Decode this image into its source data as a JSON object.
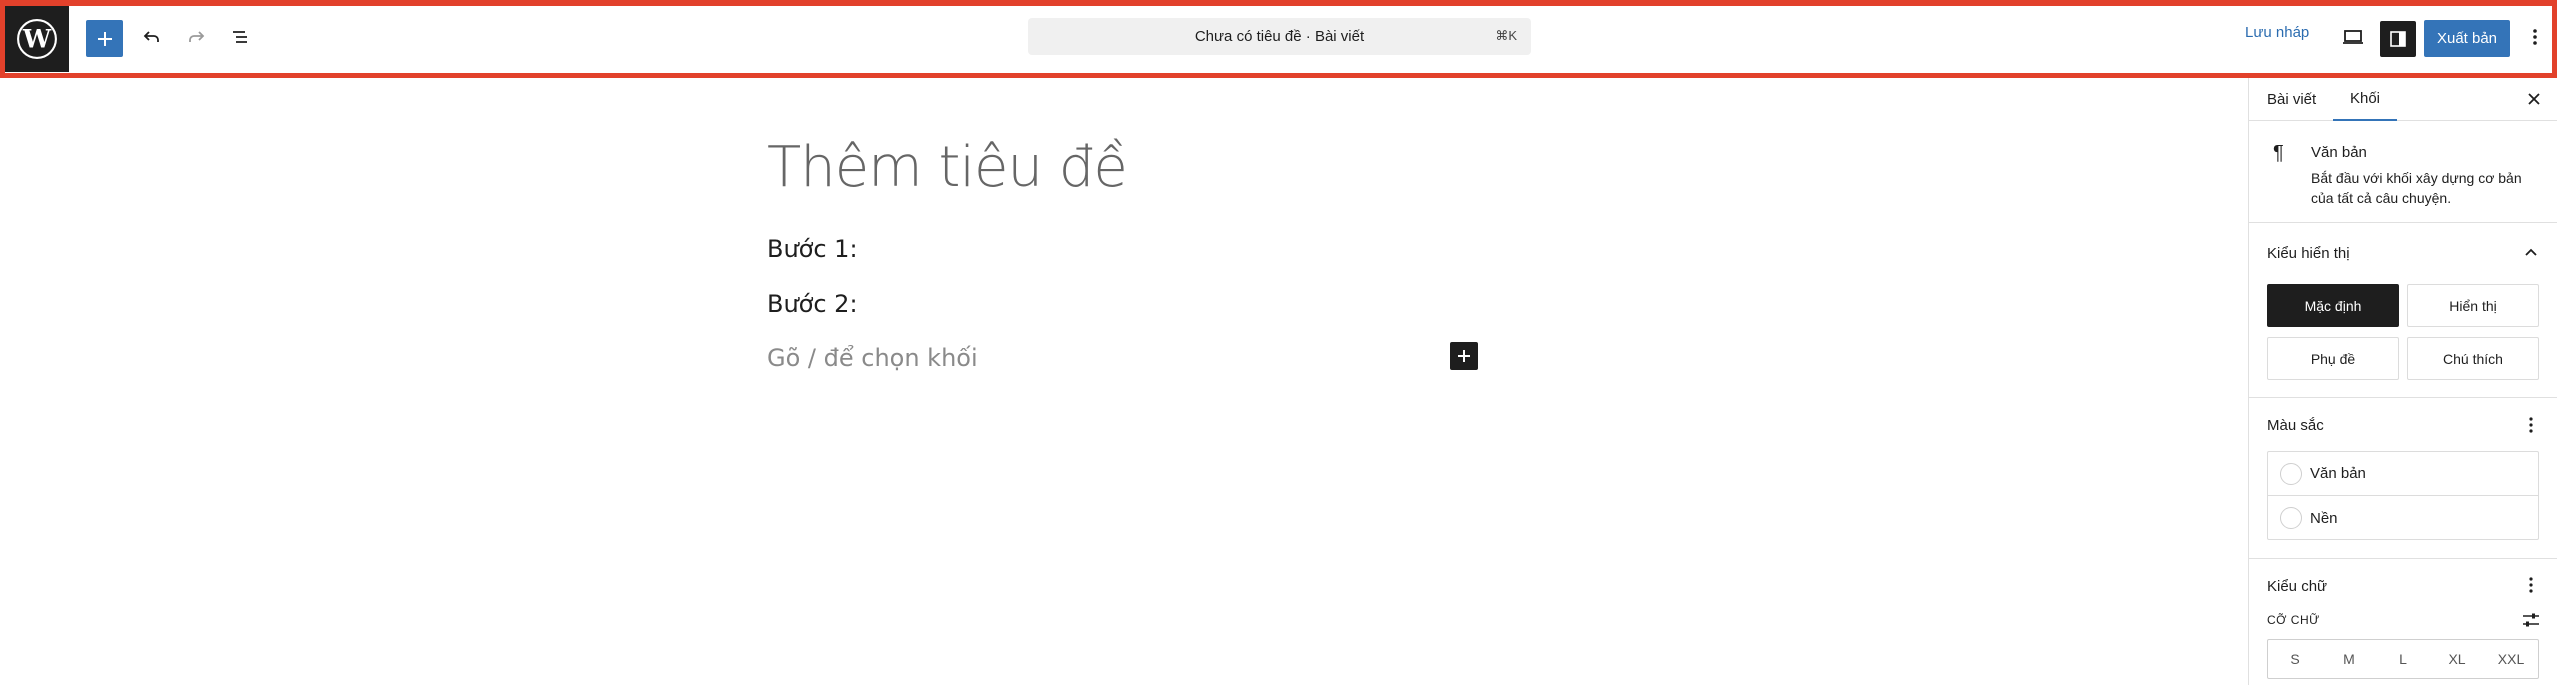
{
  "toolbar": {
    "document_title": "Chưa có tiêu đề · Bài viết",
    "shortcut": "⌘K",
    "save_draft": "Lưu nháp",
    "publish": "Xuất bản",
    "icons": [
      "wordpress-logo",
      "plus-icon",
      "undo-icon",
      "redo-icon",
      "list-view-icon",
      "desktop-preview-icon",
      "sidebar-toggle-icon",
      "more-vertical-icon"
    ]
  },
  "editor": {
    "title_placeholder": "Thêm tiêu đề",
    "paragraphs": [
      "Bước 1:",
      "Bước 2:"
    ],
    "block_placeholder": "Gõ / để chọn khối"
  },
  "sidebar": {
    "tabs": [
      "Bài viết",
      "Khối"
    ],
    "active_tab": "Khối",
    "block": {
      "name": "Văn bản",
      "description": "Bắt đầu với khối xây dựng cơ bản của tất cả câu chuyện.",
      "icon": "pilcrow-icon"
    },
    "styles": {
      "title": "Kiểu hiển thị",
      "options": [
        "Mặc định",
        "Hiển thị",
        "Phụ đề",
        "Chú thích"
      ],
      "selected": "Mặc định"
    },
    "color": {
      "title": "Màu sắc",
      "items": [
        "Văn bản",
        "Nền"
      ]
    },
    "typography": {
      "title": "Kiểu chữ",
      "size_label": "CỠ CHỮ",
      "sizes": [
        "S",
        "M",
        "L",
        "XL",
        "XXL"
      ]
    }
  },
  "colors": {
    "accent": "#3474b8",
    "highlight_border": "#e2412b",
    "dark": "#1e1e1e"
  }
}
